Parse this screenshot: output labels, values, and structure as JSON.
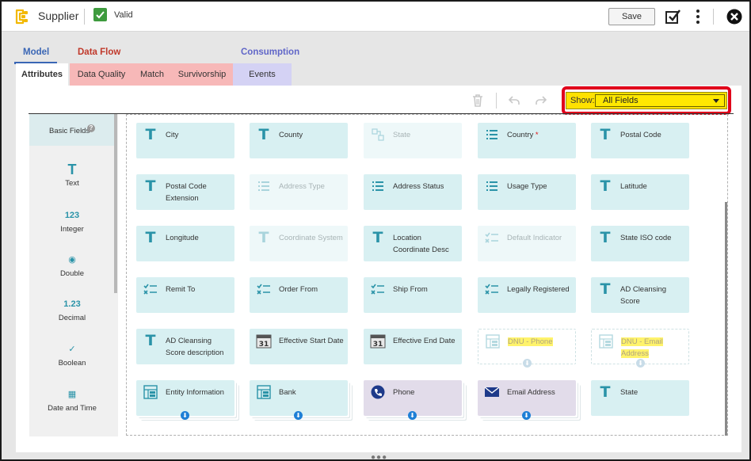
{
  "header": {
    "title": "Supplier",
    "status": "Valid",
    "save_label": "Save"
  },
  "tab_groups": {
    "model": "Model",
    "data_flow": "Data Flow",
    "consumption": "Consumption"
  },
  "tabs": [
    {
      "label": "Attributes"
    },
    {
      "label": "Data Quality"
    },
    {
      "label": "Match"
    },
    {
      "label": "Survivorship"
    },
    {
      "label": "Events"
    }
  ],
  "toolbar": {
    "show_label": "Show:",
    "show_value": "All Fields"
  },
  "palette": {
    "header": "Basic Fields",
    "items": [
      {
        "label": "Text",
        "glyph": "T"
      },
      {
        "label": "Integer",
        "glyph": "123"
      },
      {
        "label": "Double",
        "glyph": "◉"
      },
      {
        "label": "Decimal",
        "glyph": "1.23"
      },
      {
        "label": "Boolean",
        "glyph": "✓"
      },
      {
        "label": "Date and Time",
        "glyph": "▦"
      }
    ]
  },
  "fields": [
    {
      "label": "City",
      "icon": "text-icon"
    },
    {
      "label": "County",
      "icon": "text-icon"
    },
    {
      "label": "State",
      "icon": "lookup-icon",
      "disabled": true
    },
    {
      "label": "Country",
      "icon": "list-icon",
      "required": "*"
    },
    {
      "label": "Postal Code",
      "icon": "text-icon"
    },
    {
      "label": "Postal Code Extension",
      "icon": "text-icon"
    },
    {
      "label": "Address Type",
      "icon": "list-icon",
      "disabled": true
    },
    {
      "label": "Address Status",
      "icon": "list-icon"
    },
    {
      "label": "Usage Type",
      "icon": "list-icon"
    },
    {
      "label": "Latitude",
      "icon": "text-icon"
    },
    {
      "label": "Longitude",
      "icon": "text-icon"
    },
    {
      "label": "Coordinate System",
      "icon": "text-icon",
      "disabled": true
    },
    {
      "label": "Location Coordinate Desc",
      "icon": "text-icon"
    },
    {
      "label": "Default Indicator",
      "icon": "boolean-icon",
      "disabled": true
    },
    {
      "label": "State ISO code",
      "icon": "text-icon"
    },
    {
      "label": "Remit To",
      "icon": "boolean-icon"
    },
    {
      "label": "Order From",
      "icon": "boolean-icon"
    },
    {
      "label": "Ship From",
      "icon": "boolean-icon"
    },
    {
      "label": "Legally Registered",
      "icon": "boolean-icon"
    },
    {
      "label": "AD Cleansing Score",
      "icon": "text-icon"
    },
    {
      "label": "AD Cleansing Score description",
      "icon": "text-icon"
    },
    {
      "label": "Effective Start Date",
      "icon": "calendar-icon",
      "calendar_day": "31"
    },
    {
      "label": "Effective End Date",
      "icon": "calendar-icon",
      "calendar_day": "31"
    },
    {
      "label": "DNU - Phone",
      "icon": "group-icon",
      "highlighted": true
    },
    {
      "label": "DNU - Email Address",
      "icon": "group-icon",
      "highlighted": true
    },
    {
      "label": "Entity Information",
      "icon": "group-icon"
    },
    {
      "label": "Bank",
      "icon": "group-icon"
    },
    {
      "label": "Phone",
      "icon": "phone-icon"
    },
    {
      "label": "Email Address",
      "icon": "email-icon"
    },
    {
      "label": "State",
      "icon": "text-icon"
    }
  ],
  "colors": {
    "accent": "#2a93a8",
    "card": "#d8f0f2",
    "card_purple": "#e2dcea",
    "highlight": "#e0001b",
    "yellow": "#ffe100",
    "model": "#3a66b5",
    "data_flow": "#c0392b",
    "consumption": "#6066c8"
  }
}
